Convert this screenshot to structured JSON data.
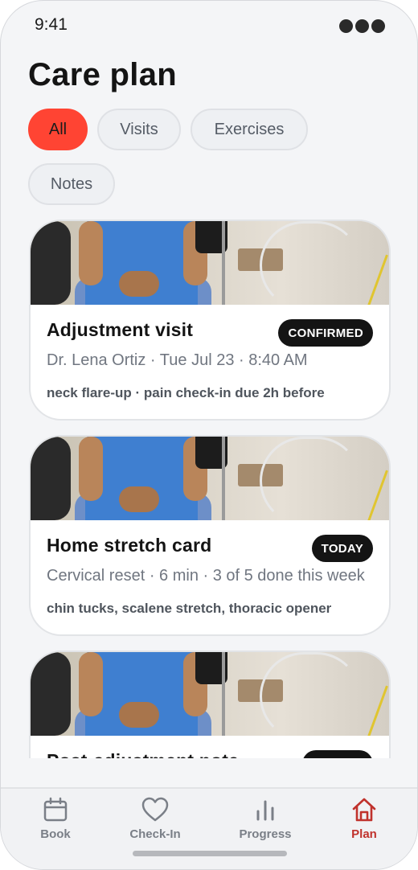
{
  "status_bar": {
    "time": "9:41"
  },
  "page": {
    "title": "Care plan"
  },
  "filters": [
    {
      "label": "All",
      "active": true
    },
    {
      "label": "Visits",
      "active": false
    },
    {
      "label": "Exercises",
      "active": false
    },
    {
      "label": "Notes",
      "active": false
    }
  ],
  "cards": [
    {
      "title": "Adjustment visit",
      "badge": "CONFIRMED",
      "meta": "Dr. Lena Ortiz · Tue Jul 23 · 8:40 AM",
      "tags": "neck flare-up · pain check-in due 2h before"
    },
    {
      "title": "Home stretch card",
      "badge": "TODAY",
      "meta": "Cervical reset · 6 min · 3 of 5 done this week",
      "tags": "chin tucks, scalene stretch, thoracic opener"
    },
    {
      "title": "Post-adjustment note",
      "badge": "",
      "meta": "",
      "tags": ""
    }
  ],
  "tabs": [
    {
      "label": "Book",
      "icon": "calendar-icon",
      "active": false
    },
    {
      "label": "Check-In",
      "icon": "heart-icon",
      "active": false
    },
    {
      "label": "Progress",
      "icon": "bar-chart-icon",
      "active": false
    },
    {
      "label": "Plan",
      "icon": "home-icon",
      "active": true
    }
  ],
  "colors": {
    "accent": "#ff4433",
    "active_tab": "#c0322c",
    "badge_bg": "#141414"
  }
}
